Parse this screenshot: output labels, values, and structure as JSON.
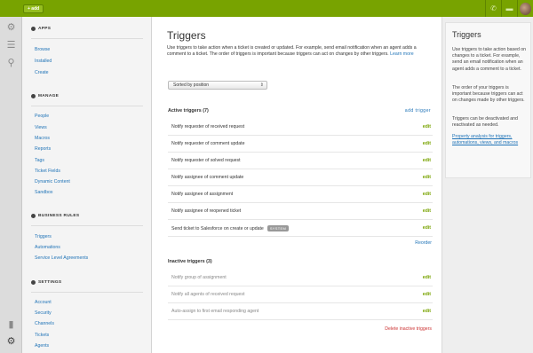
{
  "topbar": {
    "add_label": "+ add",
    "phone_icon": "phone-icon",
    "chat_icon": "chat-icon"
  },
  "nav": {
    "apps": {
      "title": "APPS",
      "items": [
        "Browse",
        "Installed",
        "Create"
      ]
    },
    "manage": {
      "title": "MANAGE",
      "items": [
        "People",
        "Views",
        "Macros",
        "Reports",
        "Tags",
        "Ticket Fields",
        "Dynamic Content",
        "Sandbox"
      ]
    },
    "business_rules": {
      "title": "BUSINESS RULES",
      "items": [
        "Triggers",
        "Automations",
        "Service Level Agreements"
      ]
    },
    "settings": {
      "title": "SETTINGS",
      "items": [
        "Account",
        "Security",
        "Channels",
        "Tickets",
        "Agents"
      ]
    }
  },
  "main": {
    "title": "Triggers",
    "intro": "Use triggers to take action when a ticket is created or updated. For example, send email notification when an agent adds a comment to a ticket. The order of triggers is important because triggers can act on changes by other triggers.",
    "learn_more": "Learn more",
    "sort_label": "Sorted by position",
    "active_heading": "Active triggers (7)",
    "add_trigger": "add trigger",
    "edit_label": "edit",
    "active": [
      {
        "name": "Notify requester of received request"
      },
      {
        "name": "Notify requester of comment update"
      },
      {
        "name": "Notify requester of solved request"
      },
      {
        "name": "Notify assignee of comment update"
      },
      {
        "name": "Notify assignee of assignment"
      },
      {
        "name": "Notify assignee of reopened ticket"
      },
      {
        "name": "Send ticket to Salesforce on create or update",
        "badge": "SYSTEM"
      }
    ],
    "reorder": "Reorder",
    "inactive_heading": "Inactive triggers (3)",
    "inactive": [
      {
        "name": "Notify group of assignment"
      },
      {
        "name": "Notify all agents of received request"
      },
      {
        "name": "Auto-assign to first email responding agent"
      }
    ],
    "delete_inactive": "Delete inactive triggers"
  },
  "help": {
    "title": "Triggers",
    "p1": "Use triggers to take action based on changes to a ticket. For example, send an email notification when an agent adds a comment to a ticket.",
    "p2": "The order of your triggers is important because triggers can act on changes made by other triggers.",
    "p3": "Triggers can be deactivated and reactivated as needed.",
    "link": "Property analysis for triggers, automations, views, and macros"
  }
}
